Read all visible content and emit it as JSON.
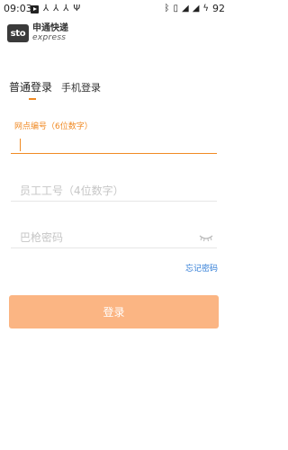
{
  "status_bar": {
    "time": "09:03",
    "battery": "92",
    "left_icons": [
      "play-icon",
      "usb-icon",
      "usb-icon",
      "usb-icon",
      "usb-icon"
    ],
    "right_icons": [
      "bluetooth-icon",
      "vibrate-icon",
      "signal-icon",
      "signal-icon",
      "charging-icon"
    ]
  },
  "logo": {
    "badge": "sto",
    "name_cn": "申通快递",
    "name_en": "express"
  },
  "tabs": [
    {
      "label": "普通登录",
      "active": true
    },
    {
      "label": "手机登录",
      "active": false
    }
  ],
  "form": {
    "branch_label": "网点编号（6位数字）",
    "branch_value": "",
    "employee_placeholder": "员工工号（4位数字）",
    "password_placeholder": "巴枪密码",
    "forgot_label": "忘记密码",
    "login_label": "登录"
  },
  "colors": {
    "accent": "#f08a24",
    "button": "#fbb583",
    "link": "#2e7bd6"
  }
}
